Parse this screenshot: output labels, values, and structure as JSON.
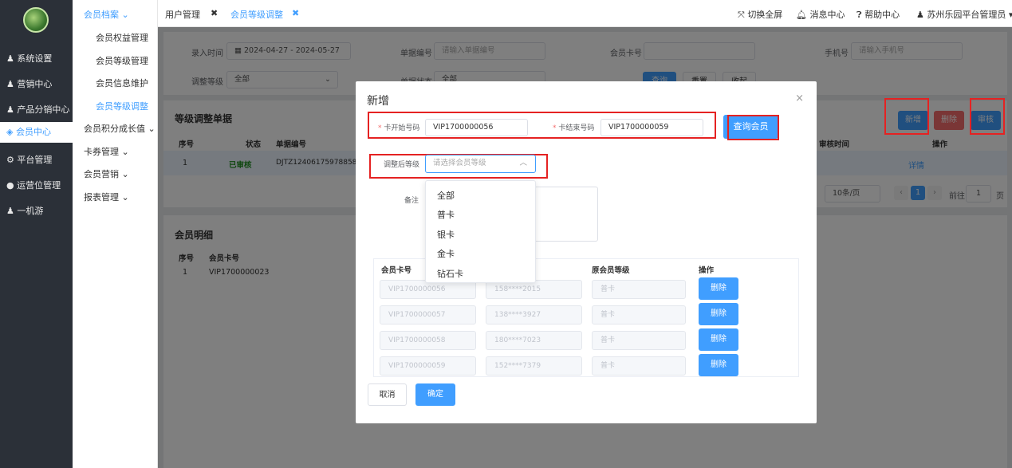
{
  "sidebar": {
    "items": [
      "系统设置",
      "营销中心",
      "产品分销中心",
      "会员中心",
      "平台管理",
      "运营位管理",
      "一机游"
    ]
  },
  "submenu": {
    "group": "会员档案 ⌄",
    "items": [
      "会员权益管理",
      "会员等级管理",
      "会员信息维护",
      "会员等级调整"
    ],
    "others": [
      "会员积分成长值 ⌄",
      "卡券管理 ⌄",
      "会员营销 ⌄",
      "报表管理 ⌄"
    ]
  },
  "topbar": {
    "tabs": [
      "用户管理",
      "会员等级调整"
    ],
    "right": [
      "切换全屏",
      "消息中心",
      "帮助中心",
      "苏州乐园平台管理员"
    ]
  },
  "filter": {
    "entry_time_label": "录入时间",
    "date_start": "2024-04-27",
    "date_sep": "-",
    "date_end": "2024-05-27",
    "doc_no_label": "单据编号",
    "doc_no_ph": "请输入单据编号",
    "card_label": "会员卡号",
    "phone_label": "手机号",
    "phone_ph": "请输入手机号",
    "adj_level_label": "调整等级",
    "adj_level_val": "全部",
    "doc_status_label": "单据状态",
    "doc_status_val": "全部",
    "query_btn": "查询",
    "reset_btn": "重置",
    "collapse_btn": "收起"
  },
  "table": {
    "title": "等级调整单据",
    "cols": [
      "序号",
      "状态",
      "单据编号",
      "审核时间",
      "操作"
    ],
    "row": {
      "no": "1",
      "status": "已审核",
      "doc": "DJTZ12406175978858...",
      "op": "详情"
    },
    "page_size": "10条/页",
    "page": "1",
    "goto": "前往",
    "goto_val": "1",
    "goto_unit": "页",
    "add_btn": "新增",
    "del_btn": "删除",
    "audit_btn": "审核"
  },
  "detail": {
    "title": "会员明细",
    "cols": [
      "序号",
      "会员卡号"
    ],
    "row": {
      "no": "1",
      "card": "VIP1700000023"
    }
  },
  "modal": {
    "title": "新增",
    "start_label": "卡开始号码",
    "start_val": "VIP1700000056",
    "end_label": "卡结束号码",
    "end_val": "VIP1700000059",
    "query_btn": "查询会员",
    "level_label": "调整后等级",
    "level_ph": "请选择会员等级",
    "remark_label": "备注",
    "options": [
      "全部",
      "普卡",
      "银卡",
      "金卡",
      "钻石卡"
    ],
    "cols": [
      "会员卡号",
      "原会员等级",
      "操作"
    ],
    "rows": [
      {
        "card": "VIP1700000056",
        "phone": "158****2015",
        "level": "普卡",
        "op": "删除"
      },
      {
        "card": "VIP1700000057",
        "phone": "138****3927",
        "level": "普卡",
        "op": "删除"
      },
      {
        "card": "VIP1700000058",
        "phone": "180****7023",
        "level": "普卡",
        "op": "删除"
      },
      {
        "card": "VIP1700000059",
        "phone": "152****7379",
        "level": "普卡",
        "op": "删除"
      }
    ],
    "cancel_btn": "取消",
    "ok_btn": "确定"
  },
  "colors": {
    "accent": "#409eff",
    "sidebar": "#2b3038",
    "danger": "#e52222",
    "green": "#1e8e1e"
  }
}
